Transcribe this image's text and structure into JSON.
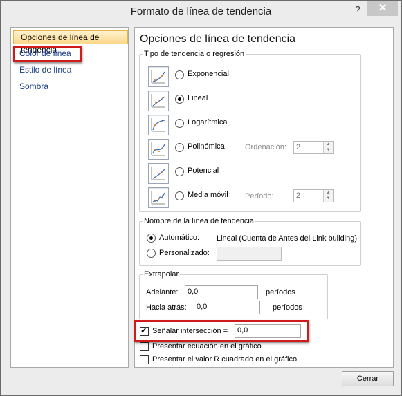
{
  "window": {
    "title": "Formato de línea de tendencia",
    "help_label": "?",
    "close_label": "✕"
  },
  "nav": {
    "items": [
      {
        "label": "Opciones de línea de tendencia"
      },
      {
        "label": "Color de línea"
      },
      {
        "label": "Estilo de línea"
      },
      {
        "label": "Sombra"
      }
    ]
  },
  "content": {
    "title": "Opciones de línea de tendencia",
    "trend_type": {
      "legend": "Tipo de tendencia o regresión",
      "options": [
        {
          "label": "Exponencial",
          "selected": false
        },
        {
          "label": "Lineal",
          "selected": true
        },
        {
          "label": "Logarítmica",
          "selected": false
        },
        {
          "label": "Polinómica",
          "selected": false
        },
        {
          "label": "Potencial",
          "selected": false
        },
        {
          "label": "Media móvil",
          "selected": false
        }
      ],
      "order": {
        "label": "Ordenación:",
        "value": "2"
      },
      "period": {
        "label": "Período:",
        "value": "2"
      }
    },
    "trend_name": {
      "legend": "Nombre de la línea de tendencia",
      "automatic_label": "Automático:",
      "automatic_value": "Lineal (Cuenta de Antes del Link building)",
      "custom_label": "Personalizado:",
      "custom_value": ""
    },
    "extrapolate": {
      "legend": "Extrapolar",
      "forward_label": "Adelante:",
      "forward_value": "0,0",
      "forward_unit": "períodos",
      "backward_label": "Hacia atrás:",
      "backward_value": "0,0",
      "backward_unit": "períodos"
    },
    "intercept": {
      "label": "Señalar intersección =",
      "value": "0,0",
      "checked": true
    },
    "show_equation": {
      "label": "Presentar ecuación en el gráfico",
      "checked": false
    },
    "show_r2": {
      "label": "Presentar el valor R cuadrado en el gráfico",
      "checked": false
    }
  },
  "footer": {
    "close_button": "Cerrar"
  },
  "colors": {
    "highlight_red": "#d11a1a",
    "selection_gold": "#fbd88a",
    "link_blue": "#1a3e8a"
  }
}
